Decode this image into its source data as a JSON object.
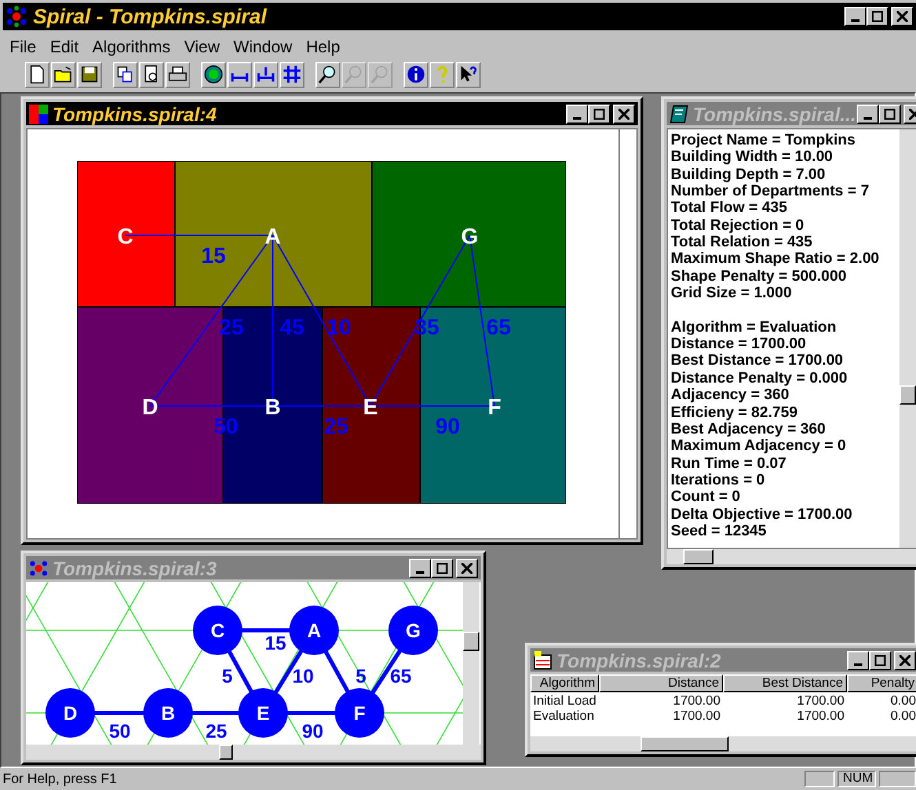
{
  "window": {
    "title": "Spiral - Tompkins.spiral"
  },
  "menu": [
    {
      "label": "File"
    },
    {
      "label": "Edit"
    },
    {
      "label": "Algorithms"
    },
    {
      "label": "View"
    },
    {
      "label": "Window"
    },
    {
      "label": "Help"
    }
  ],
  "toolbar": [
    {
      "kind": "new",
      "disabled": false
    },
    {
      "kind": "open",
      "disabled": false
    },
    {
      "kind": "save",
      "disabled": false
    },
    {
      "kind": "sep"
    },
    {
      "kind": "copy",
      "disabled": false
    },
    {
      "kind": "preview",
      "disabled": false
    },
    {
      "kind": "print",
      "disabled": false
    },
    {
      "kind": "sep"
    },
    {
      "kind": "algorithm",
      "disabled": false
    },
    {
      "kind": "width",
      "disabled": false
    },
    {
      "kind": "depth",
      "disabled": false
    },
    {
      "kind": "grid",
      "disabled": false
    },
    {
      "kind": "sep"
    },
    {
      "kind": "zoom",
      "disabled": false
    },
    {
      "kind": "zoom",
      "disabled": true
    },
    {
      "kind": "zoom",
      "disabled": true
    },
    {
      "kind": "sep"
    },
    {
      "kind": "info",
      "disabled": false
    },
    {
      "kind": "help",
      "disabled": false
    },
    {
      "kind": "contexthelp",
      "disabled": false
    }
  ],
  "layout_window": {
    "title": "Tompkins.spiral:4",
    "active": true,
    "departments": [
      {
        "label": "C",
        "color": "#ff0000"
      },
      {
        "label": "A",
        "color": "#808000"
      },
      {
        "label": "G",
        "color": "#006600"
      },
      {
        "label": "D",
        "color": "#660066"
      },
      {
        "label": "B",
        "color": "#000066"
      },
      {
        "label": "E",
        "color": "#660000"
      },
      {
        "label": "F",
        "color": "#006666"
      }
    ],
    "flows": [
      {
        "value": "15"
      },
      {
        "value": "25"
      },
      {
        "value": "45"
      },
      {
        "value": "10"
      },
      {
        "value": "35"
      },
      {
        "value": "65"
      },
      {
        "value": "50"
      },
      {
        "value": "25"
      },
      {
        "value": "90"
      }
    ]
  },
  "info_window": {
    "title": "Tompkins.spiral...",
    "active": false,
    "project_lines": [
      "Project Name = Tompkins",
      "Building Width = 10.00",
      "Building Depth = 7.00",
      "Number of Departments = 7",
      "Total Flow = 435",
      "Total Rejection = 0",
      "Total Relation = 435",
      "Maximum Shape Ratio = 2.00",
      "Shape Penalty = 500.000",
      "Grid Size = 1.000"
    ],
    "algorithm_lines": [
      "Algorithm = Evaluation",
      "Distance = 1700.00",
      "Best Distance = 1700.00",
      "Distance Penalty = 0.000",
      "Adjacency = 360",
      "Efficieny = 82.759",
      "Best Adjacency = 360",
      "Maximum Adjacency = 0",
      "Run Time = 0.07",
      "Iterations = 0",
      "Count = 0",
      "Delta Objective = 1700.00",
      "Seed = 12345"
    ]
  },
  "graph_window": {
    "title": "Tompkins.spiral:3",
    "active": false,
    "nodes": [
      {
        "label": "C"
      },
      {
        "label": "A"
      },
      {
        "label": "G"
      },
      {
        "label": "D"
      },
      {
        "label": "B"
      },
      {
        "label": "E"
      },
      {
        "label": "F"
      }
    ],
    "edges": [
      {
        "value": "15"
      },
      {
        "value": "5"
      },
      {
        "value": "10"
      },
      {
        "value": "5"
      },
      {
        "value": "65"
      },
      {
        "value": "50"
      },
      {
        "value": "25"
      },
      {
        "value": "90"
      }
    ]
  },
  "table_window": {
    "title": "Tompkins.spiral:2",
    "active": false,
    "columns": [
      "Algorithm",
      "Distance",
      "Best Distance",
      "Penalty"
    ],
    "rows": [
      [
        "Initial Load",
        "1700.00",
        "1700.00",
        "0.00"
      ],
      [
        "Evaluation",
        "1700.00",
        "1700.00",
        "0.00"
      ]
    ]
  },
  "status_bar": {
    "text": "For Help, press F1",
    "indicator": "NUM"
  }
}
